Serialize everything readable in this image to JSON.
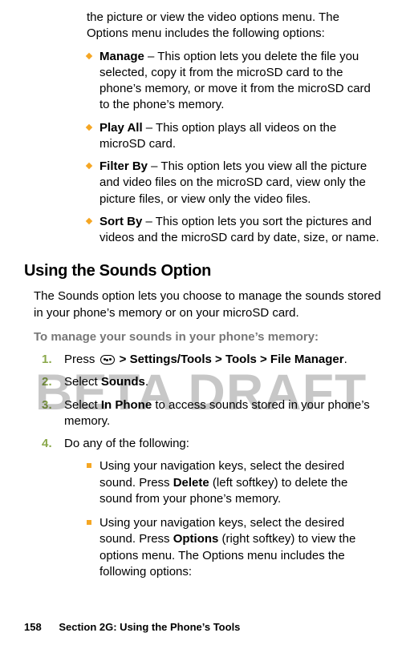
{
  "topContinuation": "the picture or view the video options menu. The Options menu includes the following options:",
  "diamonds": [
    {
      "term": "Manage",
      "text": " – This option lets you delete the file you selected, copy it from the microSD card to the phone’s memory, or move it from the microSD card to the phone’s memory."
    },
    {
      "term": "Play All",
      "text": " – This option plays all videos on the microSD card."
    },
    {
      "term": "Filter By",
      "text": " – This option lets you view all the picture and video files on the microSD card, view only the picture files, or view only the video files."
    },
    {
      "term": "Sort By",
      "text": " – This option lets you sort the pictures and videos and the microSD card by date, size, or name."
    }
  ],
  "heading": "Using the Sounds Option",
  "leadPara": "The Sounds option lets you choose to manage the sounds stored in your phone’s memory or on your microSD card.",
  "taskIntro": "To manage your sounds in your phone’s memory:",
  "steps": {
    "s1": {
      "num": "1.",
      "pre": "Press ",
      "post": " > ",
      "path": "Settings/Tools > Tools > File Manager",
      "end": "."
    },
    "s2": {
      "num": "2.",
      "pre": "Select ",
      "term": "Sounds",
      "end": "."
    },
    "s3": {
      "num": "3.",
      "pre": "Select ",
      "term": "In Phone",
      "post": " to access sounds stored in your phone’s memory."
    },
    "s4": {
      "num": "4.",
      "text": "Do any of the following:"
    }
  },
  "squares": [
    {
      "preA": "Using your navigation keys, select the desired sound. Press ",
      "termA": "Delete",
      "postA": " (left softkey) to delete the sound from your phone’s memory."
    },
    {
      "preA": "Using your navigation keys, select the desired sound. Press ",
      "termA": "Options",
      "postA": " (right softkey) to view the options menu. The Options menu includes the following options:"
    }
  ],
  "watermark": "BETA DRAFT",
  "footer": {
    "pageNum": "158",
    "section": "Section 2G: Using the Phone’s Tools"
  }
}
